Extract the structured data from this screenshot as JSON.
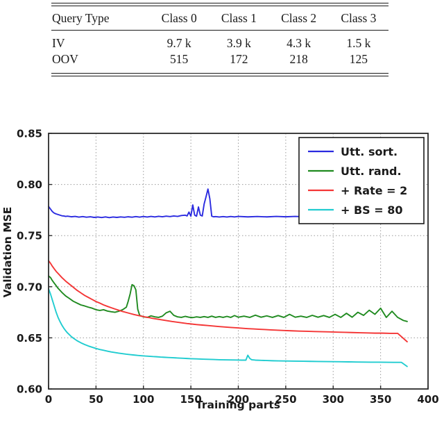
{
  "table": {
    "name": "query-type-class-counts",
    "columns": [
      "Query Type",
      "Class 0",
      "Class 1",
      "Class 2",
      "Class 3"
    ],
    "rows": [
      {
        "label": "IV",
        "values": [
          "9.7 k",
          "3.9 k",
          "4.3 k",
          "1.5 k"
        ]
      },
      {
        "label": "OOV",
        "values": [
          "515",
          "172",
          "218",
          "125"
        ]
      }
    ]
  },
  "chart_data": {
    "type": "line",
    "title": "",
    "xlabel": "Training parts",
    "ylabel": "Validation MSE",
    "xlim": [
      0,
      400
    ],
    "ylim": [
      0.6,
      0.85
    ],
    "xticks": [
      0,
      50,
      100,
      150,
      200,
      250,
      300,
      350,
      400
    ],
    "xticklabels": [
      "0",
      "50",
      "100",
      "150",
      "200",
      "250",
      "300",
      "350",
      "400"
    ],
    "yticks": [
      0.6,
      0.65,
      0.7,
      0.75,
      0.8,
      0.85
    ],
    "yticklabels": [
      "0.60",
      "0.65",
      "0.70",
      "0.75",
      "0.80",
      "0.85"
    ],
    "grid": true,
    "grid_style": "dotted",
    "legend_position": "upper right",
    "legend_entries": [
      "Utt. sort.",
      "Utt. rand.",
      "+ Rate = 2",
      "+ BS = 80"
    ],
    "colors": {
      "utt_sort": "#2a2ae0",
      "utt_rand": "#1f8a1f",
      "rate_2": "#f43535",
      "bs_80": "#20ccd0",
      "axis": "#2b2b2b",
      "grid": "#9a9a9a",
      "background": "#ffffff"
    },
    "series": [
      {
        "name": "Utt. sort.",
        "color_key": "utt_sort",
        "x": [
          0,
          2,
          4,
          6,
          8,
          10,
          12,
          14,
          16,
          18,
          20,
          24,
          28,
          32,
          36,
          40,
          44,
          48,
          52,
          56,
          60,
          64,
          68,
          72,
          76,
          80,
          84,
          88,
          92,
          96,
          100,
          104,
          108,
          112,
          116,
          120,
          124,
          128,
          132,
          136,
          140,
          144,
          146,
          148,
          150,
          152,
          154,
          156,
          158,
          160,
          162,
          164,
          166,
          168,
          170,
          172,
          174,
          176,
          180,
          184,
          188,
          192,
          196,
          200,
          210,
          220,
          230,
          240,
          250,
          260,
          270,
          280,
          290,
          300,
          310,
          320,
          330,
          340,
          350,
          360,
          370,
          378
        ],
        "y": [
          0.7785,
          0.776,
          0.7735,
          0.772,
          0.7712,
          0.7706,
          0.77,
          0.7694,
          0.7692,
          0.7688,
          0.769,
          0.7684,
          0.7688,
          0.7681,
          0.7686,
          0.768,
          0.7684,
          0.7678,
          0.7682,
          0.7677,
          0.7683,
          0.7676,
          0.7682,
          0.7678,
          0.7683,
          0.7679,
          0.7684,
          0.768,
          0.7686,
          0.7681,
          0.7687,
          0.7682,
          0.7688,
          0.7683,
          0.7689,
          0.7684,
          0.769,
          0.7686,
          0.7692,
          0.7688,
          0.7696,
          0.77,
          0.7692,
          0.773,
          0.769,
          0.78,
          0.77,
          0.769,
          0.778,
          0.77,
          0.7692,
          0.781,
          0.788,
          0.7955,
          0.786,
          0.769,
          0.7684,
          0.7686,
          0.7682,
          0.7686,
          0.7682,
          0.7687,
          0.7683,
          0.7688,
          0.7683,
          0.7687,
          0.7683,
          0.7688,
          0.7684,
          0.7688,
          0.7684,
          0.7689,
          0.7684,
          0.7688,
          0.7683,
          0.7687,
          0.7683,
          0.7688,
          0.7684,
          0.7688,
          0.7684,
          0.7686
        ]
      },
      {
        "name": "Utt. rand.",
        "color_key": "utt_rand",
        "x": [
          0,
          2,
          4,
          6,
          8,
          10,
          14,
          18,
          22,
          26,
          30,
          34,
          38,
          42,
          46,
          50,
          54,
          58,
          62,
          66,
          70,
          74,
          78,
          82,
          84,
          86,
          88,
          90,
          92,
          94,
          96,
          100,
          104,
          108,
          112,
          116,
          120,
          124,
          128,
          132,
          136,
          140,
          144,
          148,
          152,
          156,
          160,
          164,
          168,
          172,
          176,
          180,
          184,
          188,
          192,
          196,
          200,
          206,
          212,
          218,
          224,
          230,
          236,
          242,
          248,
          254,
          260,
          266,
          272,
          278,
          284,
          290,
          296,
          302,
          308,
          314,
          320,
          326,
          332,
          338,
          344,
          350,
          356,
          362,
          368,
          374,
          378
        ],
        "y": [
          0.7105,
          0.709,
          0.706,
          0.7035,
          0.701,
          0.6985,
          0.6945,
          0.691,
          0.6885,
          0.6858,
          0.684,
          0.6822,
          0.6812,
          0.68,
          0.679,
          0.6775,
          0.6768,
          0.6775,
          0.6762,
          0.6755,
          0.675,
          0.676,
          0.6775,
          0.68,
          0.686,
          0.693,
          0.702,
          0.701,
          0.697,
          0.678,
          0.672,
          0.6705,
          0.67,
          0.6715,
          0.6705,
          0.67,
          0.6712,
          0.6745,
          0.676,
          0.672,
          0.6705,
          0.67,
          0.671,
          0.6702,
          0.6698,
          0.6705,
          0.67,
          0.6708,
          0.67,
          0.6712,
          0.67,
          0.6708,
          0.67,
          0.671,
          0.67,
          0.6718,
          0.6702,
          0.6712,
          0.67,
          0.6722,
          0.6702,
          0.6715,
          0.67,
          0.6718,
          0.67,
          0.673,
          0.6702,
          0.6712,
          0.67,
          0.672,
          0.6702,
          0.6718,
          0.67,
          0.673,
          0.67,
          0.674,
          0.6702,
          0.675,
          0.672,
          0.677,
          0.673,
          0.679,
          0.67,
          0.676,
          0.67,
          0.667,
          0.666
        ]
      },
      {
        "name": "+ Rate = 2",
        "color_key": "rate_2",
        "x": [
          0,
          2,
          4,
          6,
          8,
          10,
          14,
          18,
          22,
          26,
          30,
          34,
          38,
          42,
          46,
          50,
          54,
          58,
          62,
          66,
          70,
          74,
          78,
          82,
          86,
          90,
          94,
          98,
          102,
          106,
          110,
          114,
          118,
          122,
          126,
          130,
          134,
          138,
          142,
          146,
          150,
          156,
          162,
          168,
          174,
          180,
          186,
          192,
          198,
          204,
          210,
          216,
          222,
          228,
          234,
          240,
          248,
          256,
          264,
          272,
          280,
          288,
          296,
          304,
          312,
          320,
          328,
          336,
          344,
          352,
          360,
          368,
          378
        ],
        "y": [
          0.7255,
          0.723,
          0.72,
          0.7175,
          0.715,
          0.713,
          0.709,
          0.7055,
          0.7025,
          0.6995,
          0.6965,
          0.694,
          0.6915,
          0.6895,
          0.6875,
          0.6855,
          0.684,
          0.6822,
          0.6808,
          0.6795,
          0.6782,
          0.677,
          0.6758,
          0.6748,
          0.6738,
          0.6728,
          0.672,
          0.6712,
          0.6704,
          0.6698,
          0.669,
          0.6684,
          0.6678,
          0.6672,
          0.6666,
          0.666,
          0.6655,
          0.665,
          0.6645,
          0.664,
          0.6636,
          0.663,
          0.6625,
          0.662,
          0.6615,
          0.661,
          0.6606,
          0.6602,
          0.6598,
          0.6594,
          0.659,
          0.6587,
          0.6584,
          0.6581,
          0.6578,
          0.6575,
          0.6572,
          0.6569,
          0.6566,
          0.6564,
          0.6562,
          0.656,
          0.6558,
          0.6556,
          0.6554,
          0.6552,
          0.655,
          0.6548,
          0.6546,
          0.6546,
          0.6544,
          0.6544,
          0.6462
        ]
      },
      {
        "name": "+ BS = 80",
        "color_key": "bs_80",
        "x": [
          0,
          2,
          4,
          6,
          8,
          10,
          12,
          14,
          16,
          18,
          20,
          22,
          24,
          26,
          28,
          30,
          34,
          38,
          42,
          46,
          50,
          54,
          58,
          62,
          66,
          70,
          74,
          78,
          82,
          86,
          90,
          94,
          98,
          102,
          106,
          110,
          114,
          118,
          122,
          126,
          130,
          134,
          138,
          142,
          146,
          150,
          156,
          162,
          168,
          174,
          180,
          186,
          192,
          198,
          204,
          208,
          210,
          212,
          214,
          218,
          224,
          230,
          236,
          242,
          248,
          254,
          260,
          268,
          276,
          284,
          292,
          300,
          308,
          316,
          324,
          332,
          340,
          348,
          356,
          364,
          372,
          378
        ],
        "y": [
          0.698,
          0.693,
          0.687,
          0.681,
          0.675,
          0.67,
          0.666,
          0.6625,
          0.6595,
          0.657,
          0.6548,
          0.653,
          0.6512,
          0.6498,
          0.6485,
          0.6472,
          0.6452,
          0.6435,
          0.642,
          0.6408,
          0.6396,
          0.6386,
          0.6378,
          0.637,
          0.6362,
          0.6356,
          0.635,
          0.6345,
          0.634,
          0.6336,
          0.6332,
          0.6328,
          0.6325,
          0.6322,
          0.632,
          0.6317,
          0.6315,
          0.6312,
          0.631,
          0.6308,
          0.6306,
          0.6304,
          0.6302,
          0.63,
          0.6298,
          0.6296,
          0.6294,
          0.6292,
          0.629,
          0.6288,
          0.6286,
          0.6285,
          0.6284,
          0.6283,
          0.6282,
          0.6282,
          0.633,
          0.63,
          0.6286,
          0.6282,
          0.628,
          0.6278,
          0.6276,
          0.6275,
          0.6274,
          0.6273,
          0.6272,
          0.6271,
          0.627,
          0.6269,
          0.6268,
          0.6267,
          0.6266,
          0.6265,
          0.6264,
          0.6263,
          0.6262,
          0.6262,
          0.6261,
          0.626,
          0.626,
          0.622
        ]
      }
    ]
  }
}
